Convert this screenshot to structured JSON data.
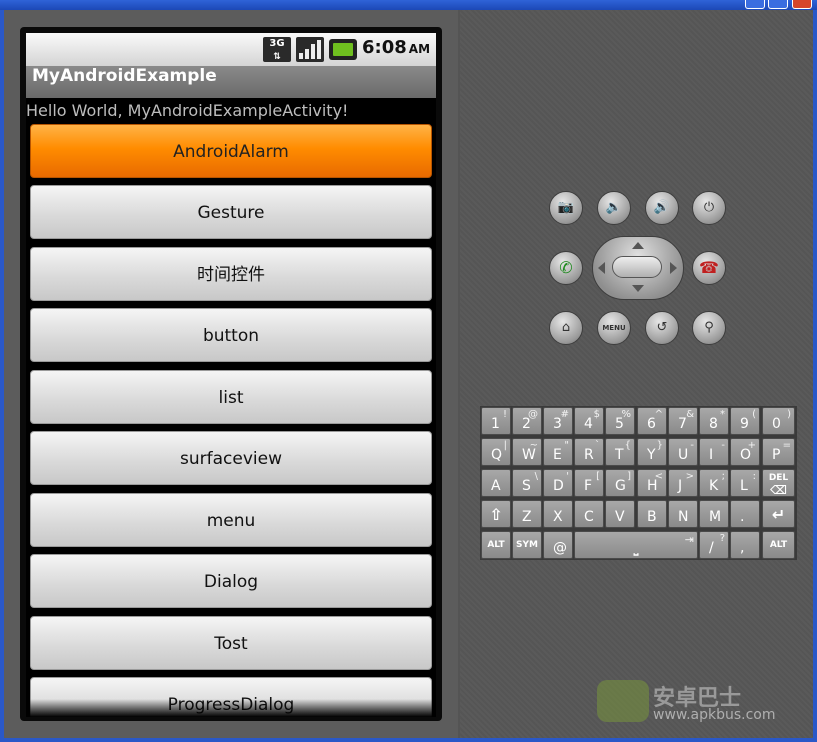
{
  "status_bar": {
    "network": "3G",
    "time": "6:08",
    "ampm": "AM"
  },
  "app": {
    "title": "MyAndroidExample",
    "hello_text": "Hello World, MyAndroidExampleActivity!",
    "buttons": [
      {
        "label": "AndroidAlarm"
      },
      {
        "label": "Gesture"
      },
      {
        "label": "时间控件"
      },
      {
        "label": "button"
      },
      {
        "label": "list"
      },
      {
        "label": "surfaceview"
      },
      {
        "label": "menu"
      },
      {
        "label": "Dialog"
      },
      {
        "label": "Tost"
      },
      {
        "label": "ProgressDialog"
      }
    ],
    "focused_button_color": "#ff8c00"
  },
  "hardware": {
    "row1": [
      "camera-icon",
      "volume-down-icon",
      "volume-up-icon",
      "power-icon"
    ],
    "row2": [
      "call-icon",
      "dpad",
      "end-call-icon"
    ],
    "row3": [
      "home-icon",
      "menu",
      "back-icon",
      "search-icon"
    ],
    "menu_label": "MENU"
  },
  "keyboard": {
    "row1": [
      [
        "1",
        "!"
      ],
      [
        "2",
        "@"
      ],
      [
        "3",
        "#"
      ],
      [
        "4",
        "$"
      ],
      [
        "5",
        "%"
      ],
      [
        "6",
        "^"
      ],
      [
        "7",
        "&"
      ],
      [
        "8",
        "*"
      ],
      [
        "9",
        "("
      ],
      [
        "0",
        ")"
      ]
    ],
    "row2": [
      [
        "Q",
        "|"
      ],
      [
        "W",
        "~"
      ],
      [
        "E",
        "\""
      ],
      [
        "R",
        "`"
      ],
      [
        "T",
        "{"
      ],
      [
        "Y",
        "}"
      ],
      [
        "U",
        "-"
      ],
      [
        "I",
        "-"
      ],
      [
        "O",
        "+"
      ],
      [
        "P",
        "="
      ]
    ],
    "row3": [
      [
        "A",
        ""
      ],
      [
        "S",
        "\\"
      ],
      [
        "D",
        "'"
      ],
      [
        "F",
        "["
      ],
      [
        "G",
        "]"
      ],
      [
        "H",
        "<"
      ],
      [
        "J",
        ">"
      ],
      [
        "K",
        ";"
      ],
      [
        "L",
        ":"
      ]
    ],
    "row4": [
      [
        "Z",
        ""
      ],
      [
        "X",
        ""
      ],
      [
        "C",
        ""
      ],
      [
        "V",
        ""
      ],
      [
        "B",
        ""
      ],
      [
        "N",
        ""
      ],
      [
        "M",
        ""
      ],
      [
        ".",
        ""
      ]
    ],
    "row5": [
      [
        "@",
        ""
      ],
      [
        "/",
        "?"
      ],
      [
        ",",
        ""
      ]
    ],
    "labels": {
      "alt": "ALT",
      "sym": "SYM",
      "del": "DEL"
    }
  },
  "watermark": {
    "title": "安卓巴士",
    "url": "www.apkbus.com"
  }
}
